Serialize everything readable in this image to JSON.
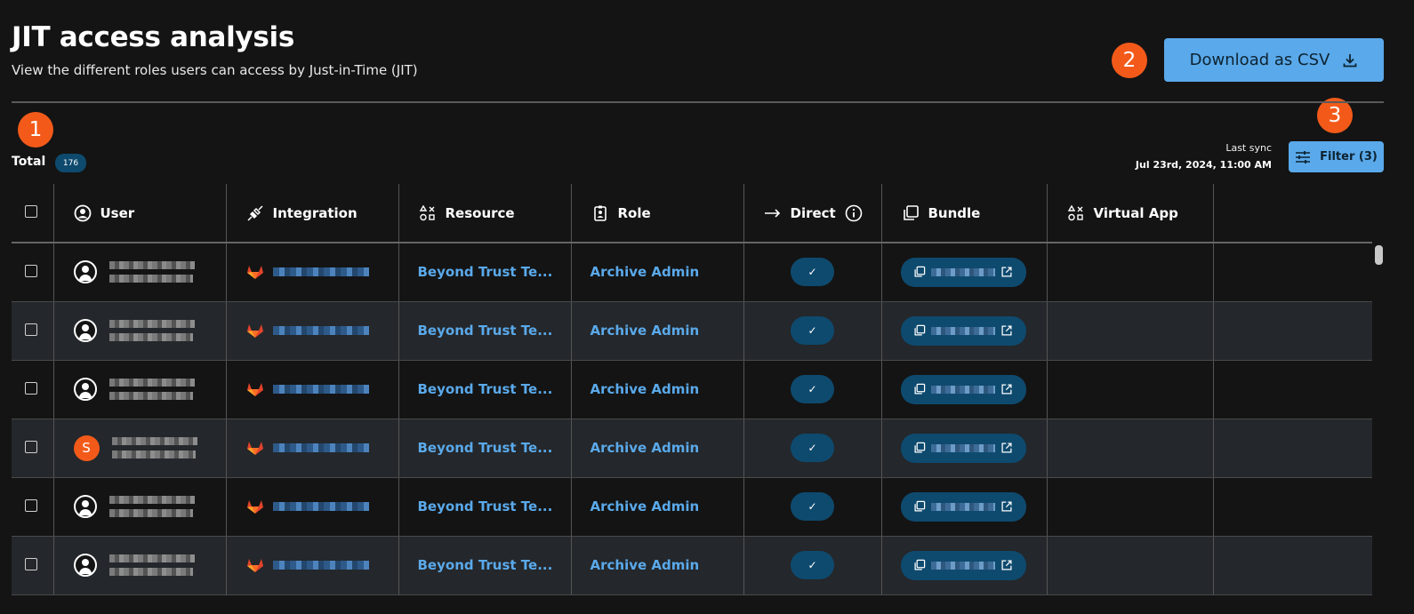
{
  "header": {
    "title": "JIT access analysis",
    "subtitle": "View the different roles users can access by Just-in-Time (JIT)",
    "download_label": "Download as CSV"
  },
  "markers": [
    "1",
    "2",
    "3"
  ],
  "summary": {
    "total_label": "Total",
    "total_count": "176",
    "last_sync_label": "Last sync",
    "last_sync_time": "Jul 23rd, 2024, 11:00 AM",
    "filter_label": "Filter (3)"
  },
  "table": {
    "columns": [
      "User",
      "Integration",
      "Resource",
      "Role",
      "Direct",
      "Bundle",
      "Virtual App"
    ],
    "rows": [
      {
        "avatar": "user-icon",
        "resource": "Beyond Trust Te...",
        "role": "Archive Admin",
        "direct": "✓"
      },
      {
        "avatar": "user-icon",
        "resource": "Beyond Trust Te...",
        "role": "Archive Admin",
        "direct": "✓"
      },
      {
        "avatar": "user-icon",
        "resource": "Beyond Trust Te...",
        "role": "Archive Admin",
        "direct": "✓"
      },
      {
        "avatar": "S",
        "resource": "Beyond Trust Te...",
        "role": "Archive Admin",
        "direct": "✓"
      },
      {
        "avatar": "user-icon",
        "resource": "Beyond Trust Te...",
        "role": "Archive Admin",
        "direct": "✓"
      },
      {
        "avatar": "user-icon",
        "resource": "Beyond Trust Te...",
        "role": "Archive Admin",
        "direct": "✓"
      }
    ]
  },
  "colors": {
    "background": "#141414",
    "accent": "#5aa9ea",
    "marker": "#f35a1a",
    "pill": "#0e4a6e",
    "row_alt": "#24272b",
    "gitlab": "#e2432a"
  }
}
